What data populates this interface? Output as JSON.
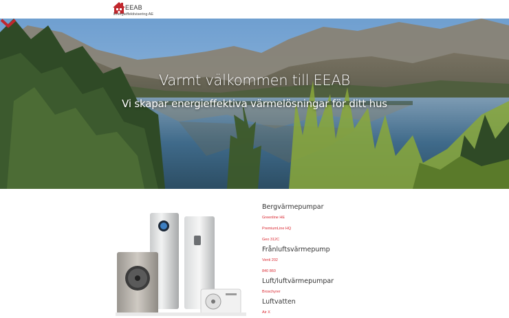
{
  "header": {
    "brand": "EEAB",
    "tagline": "Energieffektivisering AE"
  },
  "hero": {
    "title": "Varmt välkommen till EEAB",
    "subtitle": "Vi skapar energieffektiva värmelösningar för ditt hus"
  },
  "colors": {
    "accent": "#d9262f",
    "logo_red": "#c0272d",
    "text_dark": "#333333"
  },
  "products": {
    "categories": [
      {
        "title": "Bergvärmepumpar",
        "items": [
          "Greenline HE",
          "PremiumLine HQ",
          "Geo 312C"
        ]
      },
      {
        "title": "Frånluftsvärmepump",
        "items": [
          "Venti 202",
          "840 860"
        ]
      },
      {
        "title": "Luft/luftvärmepumpar",
        "items": [
          "Broschyrer"
        ]
      },
      {
        "title": "Luftvatten",
        "items": [
          "Air X"
        ]
      }
    ]
  }
}
